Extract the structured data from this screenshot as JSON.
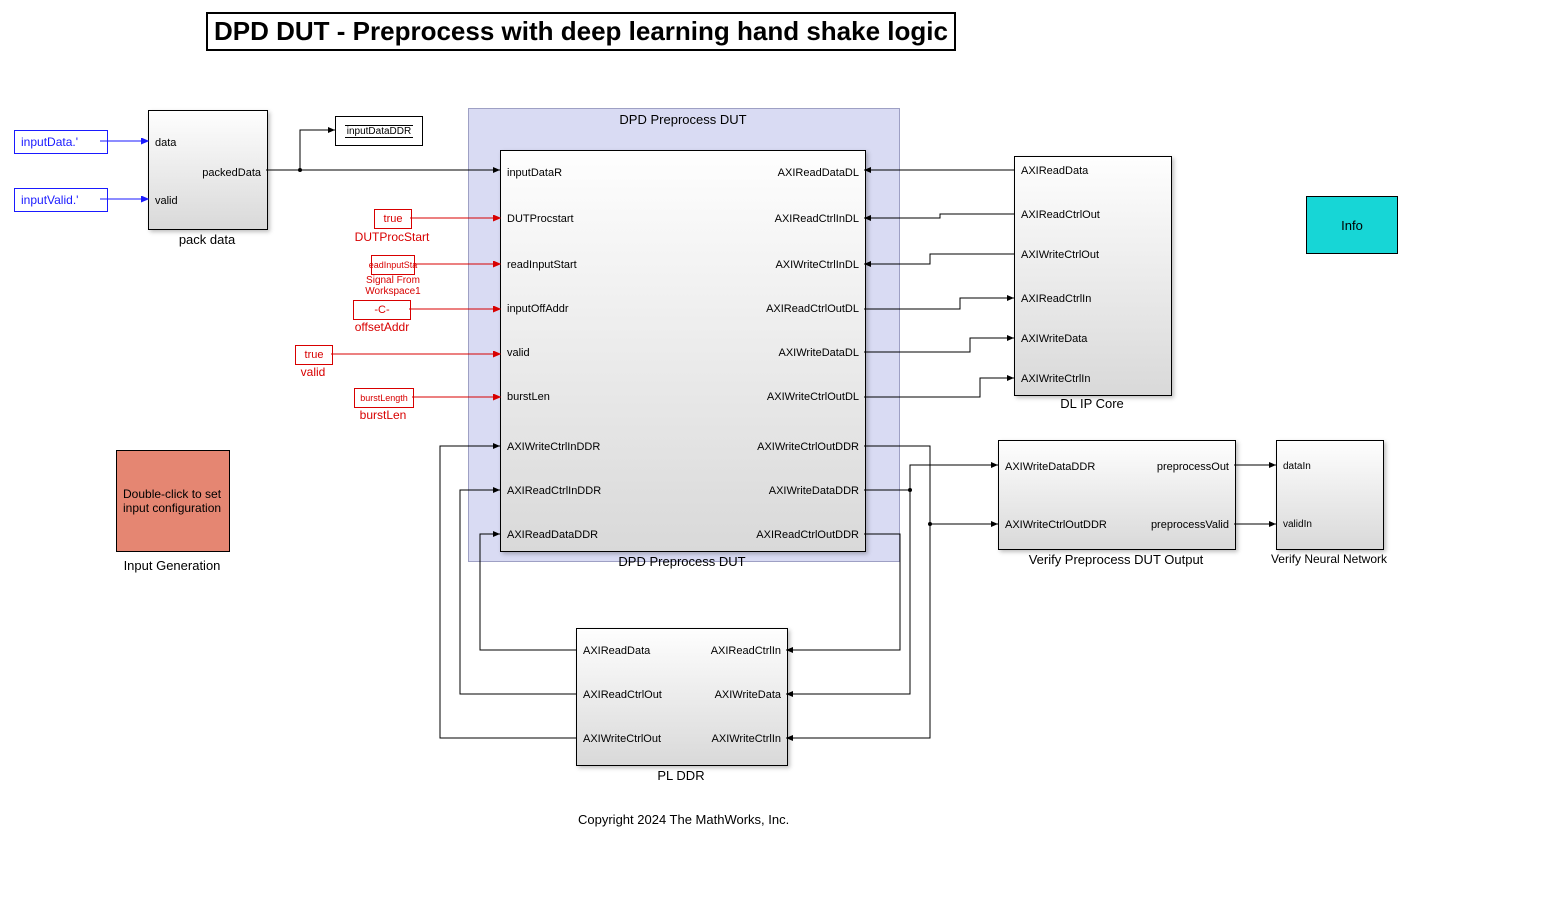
{
  "title": "DPD DUT - Preprocess with deep learning hand shake logic",
  "footer": "Copyright 2024 The MathWorks, Inc.",
  "inputs": {
    "inputData": "inputData.'",
    "inputValid": "inputValid.'"
  },
  "packData": {
    "name": "pack data",
    "port_data": "data",
    "port_valid": "valid",
    "port_out": "packedData"
  },
  "scope": {
    "label": "inputDataDDR"
  },
  "constants": {
    "procstart": {
      "box": "true",
      "label": "DUTProcStart"
    },
    "readinput": {
      "box": "eadInputSta",
      "label": "Signal From Workspace1"
    },
    "offset": {
      "box": "-C-",
      "label": "offsetAddr"
    },
    "valid": {
      "box": "true",
      "label": "valid"
    },
    "burst": {
      "box": "burstLength",
      "label": "burstLen"
    }
  },
  "inputGen": {
    "text": "Double-click to set input configuration",
    "label": "Input Generation"
  },
  "dut": {
    "topLabel": "DPD Preprocess DUT",
    "bottomLabel": "DPD Preprocess DUT",
    "ports_left": [
      "inputDataR",
      "DUTProcstart",
      "readInputStart",
      "inputOffAddr",
      "valid",
      "burstLen",
      "AXIWriteCtrlInDDR",
      "AXIReadCtrlInDDR",
      "AXIReadDataDDR"
    ],
    "ports_right": [
      "AXIReadDataDL",
      "AXIReadCtrlInDL",
      "AXIWriteCtrlInDL",
      "AXIReadCtrlOutDL",
      "AXIWriteDataDL",
      "AXIWriteCtrlOutDL",
      "AXIWriteCtrlOutDDR",
      "AXIWriteDataDDR",
      "AXIReadCtrlOutDDR"
    ]
  },
  "dlip": {
    "label": "DL IP Core",
    "ports_left": [
      "AXIReadData",
      "AXIReadCtrlOut",
      "AXIWriteCtrlOut",
      "AXIReadCtrlIn",
      "AXIWriteData",
      "AXIWriteCtrlIn"
    ]
  },
  "verify": {
    "label": "Verify Preprocess DUT Output",
    "ports_left": [
      "AXIWriteDataDDR",
      "AXIWriteCtrlOutDDR"
    ],
    "ports_right": [
      "preprocessOut",
      "preprocessValid"
    ]
  },
  "nn": {
    "label": "Verify Neural Network",
    "ports_left": [
      "dataIn",
      "validIn"
    ]
  },
  "plddr": {
    "label": "PL DDR",
    "ports_left": [
      "AXIReadData",
      "AXIReadCtrlOut",
      "AXIWriteCtrlOut"
    ],
    "ports_right": [
      "AXIReadCtrlIn",
      "AXIWriteData",
      "AXIWriteCtrlIn"
    ]
  },
  "info": "Info"
}
